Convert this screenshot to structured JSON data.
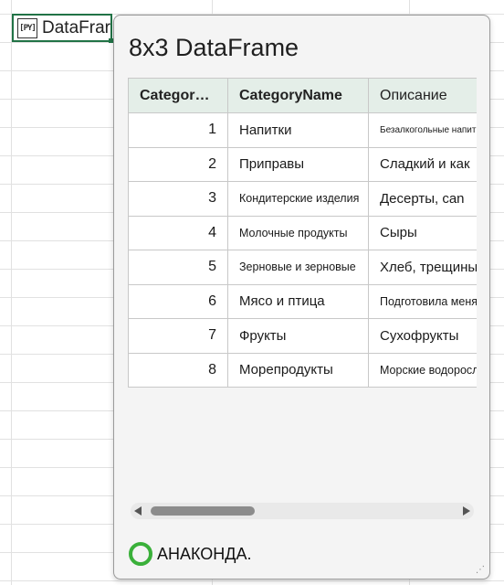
{
  "cell": {
    "icon": "python-icon",
    "icon_text": "[PY]",
    "text": "DataFrar"
  },
  "card": {
    "title": "8x3 DataFrame",
    "columns": [
      "Categor…",
      "CategoryName",
      "Описание"
    ],
    "rows": [
      {
        "id": "1",
        "name": "Напитки",
        "desc": "Безалкогольные напитки, с"
      },
      {
        "id": "2",
        "name": "Приправы",
        "desc": "Сладкий и как"
      },
      {
        "id": "3",
        "name": "Кондитерские изделия",
        "desc": "Десерты, can"
      },
      {
        "id": "4",
        "name": "Молочные продукты",
        "desc": "Сыры"
      },
      {
        "id": "5",
        "name": "Зерновые и зерновые",
        "desc": "Хлеб, трещины"
      },
      {
        "id": "6",
        "name": "Мясо и птица",
        "desc": "Подготовила меня;"
      },
      {
        "id": "7",
        "name": "Фрукты",
        "desc": "Сухофрукты"
      },
      {
        "id": "8",
        "name": "Морепродукты",
        "desc": "Морские водоросли и"
      }
    ],
    "footer": {
      "icon": "anaconda-icon",
      "text": "АНАКОНДА."
    }
  },
  "colors": {
    "accent": "#217346",
    "header_bg": "#e4eee8",
    "anaconda": "#3ab03a"
  }
}
